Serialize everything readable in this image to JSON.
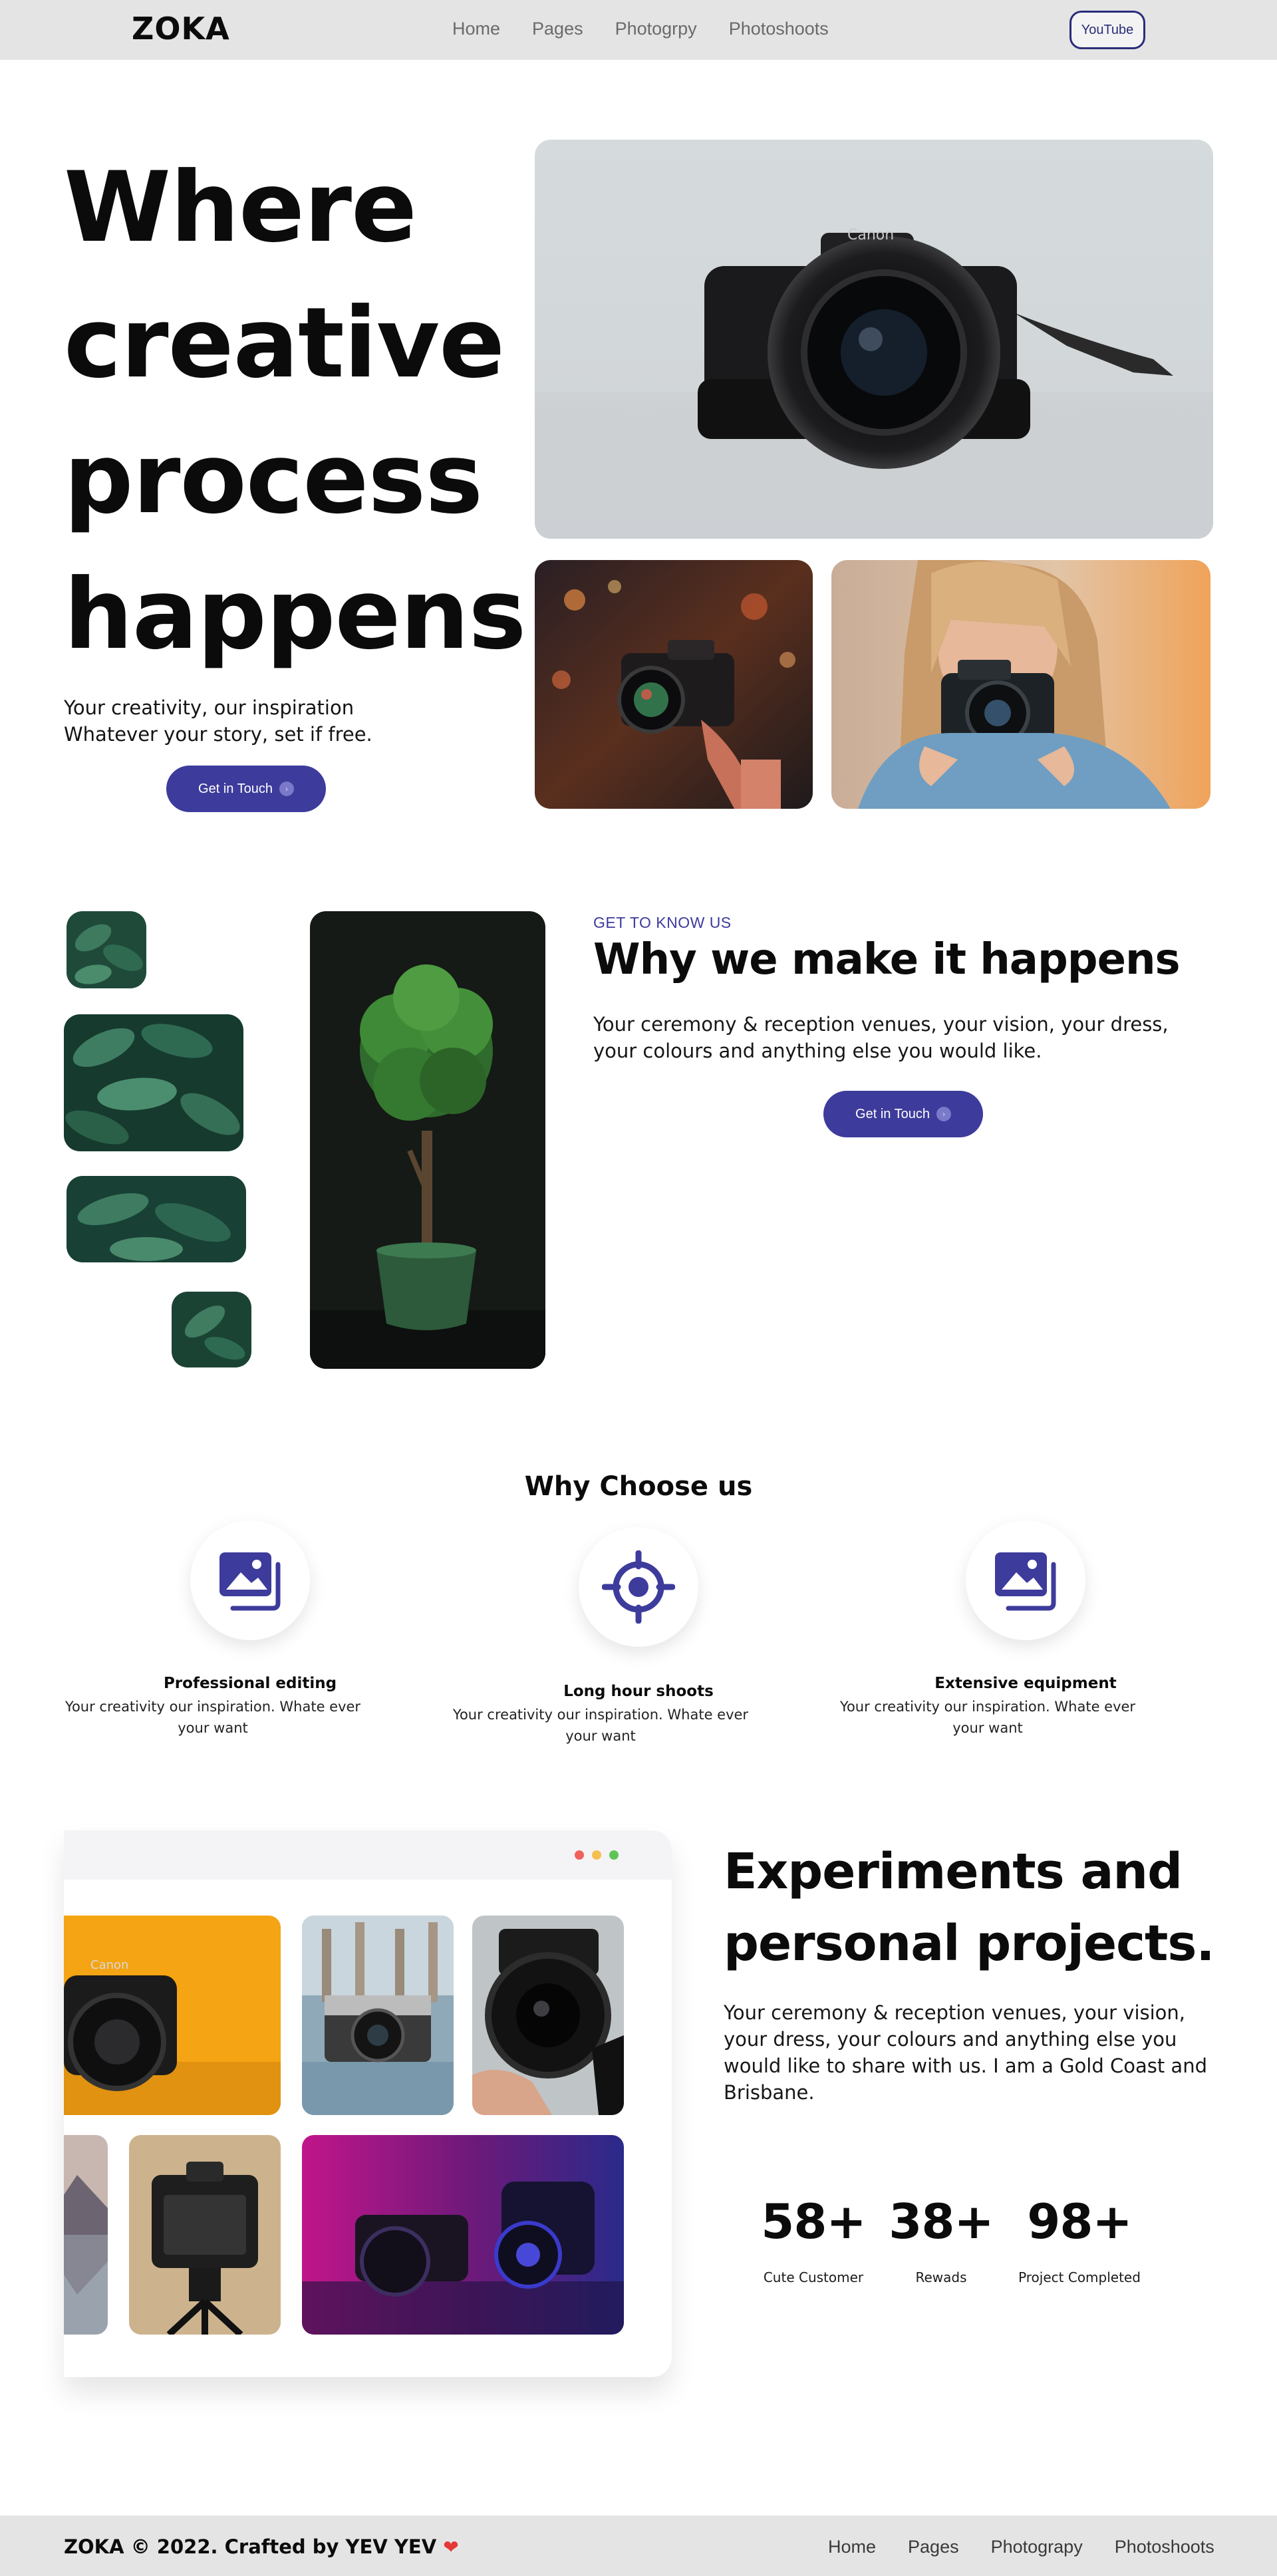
{
  "nav": {
    "logo": "ZOKA",
    "links": [
      "Home",
      "Pages",
      "Photogrpy",
      "Photoshoots"
    ],
    "youtube": "YouTube"
  },
  "hero": {
    "title": "Where creative process happens",
    "subtitle": "Your creativity, our inspiration Whatever your story, set if free.",
    "cta": "Get in Touch",
    "images": [
      "camera-on-table-photo",
      "camera-bokeh-night-photo",
      "woman-with-camera-photo"
    ]
  },
  "about": {
    "eyebrow": "GET TO KNOW US",
    "title": "Why we make it happens",
    "body": "Your ceremony & reception venues, your vision, your dress, your colours and anything else you would like.",
    "cta": "Get in Touch",
    "images": [
      "leaves-photo",
      "potted-tree-photo"
    ]
  },
  "features": {
    "title": "Why Choose us",
    "items": [
      {
        "icon": "image-gallery-icon",
        "title": "Professional editing",
        "desc": "Your creativity our inspiration. Whate ever your want"
      },
      {
        "icon": "target-crosshair-icon",
        "title": "Long hour shoots",
        "desc": "Your creativity our inspiration. Whate ever your want"
      },
      {
        "icon": "image-gallery-icon",
        "title": "Extensive equipment",
        "desc": "Your creativity our inspiration. Whate ever your want"
      }
    ]
  },
  "experiments": {
    "title": "Experiments and personal projects.",
    "body": "Your ceremony & reception venues, your vision, your dress, your colours and anything else you would like to share with us. I am a Gold Coast and Brisbane.",
    "window_dots": [
      "#f0625b",
      "#f5bf4f",
      "#5fc454"
    ],
    "stats": [
      {
        "value": "58+",
        "label": "Cute Customer"
      },
      {
        "value": "38+",
        "label": "Rewads"
      },
      {
        "value": "98+",
        "label": "Project Completed"
      }
    ]
  },
  "footer": {
    "copyright": "ZOKA © 2022. Crafted by YEV YEV",
    "links": [
      "Home",
      "Pages",
      "Photograpy",
      "Photoshoots"
    ]
  },
  "colors": {
    "accent": "#3d3b9b",
    "nav_bg": "#e4e4e4",
    "text": "#0b0b0b"
  }
}
